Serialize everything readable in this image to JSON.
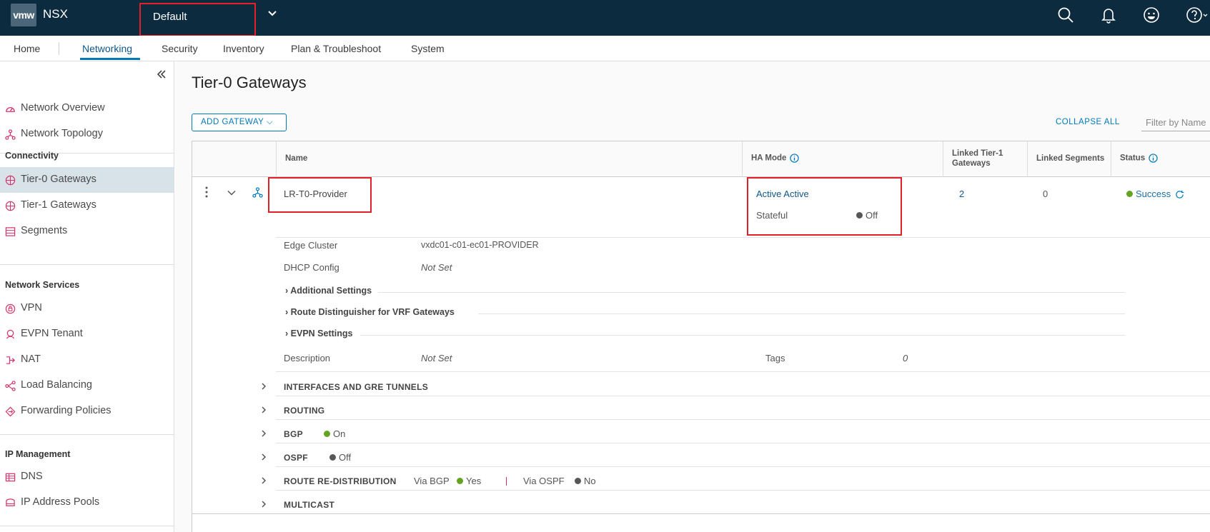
{
  "header": {
    "logo": "vmw",
    "product": "NSX",
    "project": "Default"
  },
  "nav": {
    "tabs": [
      "Home",
      "Networking",
      "Security",
      "Inventory",
      "Plan & Troubleshoot",
      "System"
    ],
    "active": "Networking"
  },
  "sidebar": {
    "top_items": [
      "Network Overview",
      "Network Topology"
    ],
    "groups": [
      {
        "title": "Connectivity",
        "items": [
          "Tier-0 Gateways",
          "Tier-1 Gateways",
          "Segments"
        ]
      },
      {
        "title": "Network Services",
        "items": [
          "VPN",
          "EVPN Tenant",
          "NAT",
          "Load Balancing",
          "Forwarding Policies"
        ]
      },
      {
        "title": "IP Management",
        "items": [
          "DNS",
          "IP Address Pools"
        ]
      }
    ],
    "active": "Tier-0 Gateways"
  },
  "page": {
    "title": "Tier-0 Gateways",
    "add_button": "ADD GATEWAY",
    "collapse_all": "COLLAPSE ALL",
    "filter_placeholder": "Filter by Name"
  },
  "table": {
    "columns": [
      "Name",
      "HA Mode",
      "Linked Tier-1 Gateways",
      "Linked Segments",
      "Status"
    ],
    "col_linked_t1_line1": "Linked Tier-1",
    "col_linked_t1_line2": "Gateways"
  },
  "gateway": {
    "name": "LR-T0-Provider",
    "ha_mode": "Active Active",
    "stateful_label": "Stateful",
    "stateful_value": "Off",
    "linked_t1": "2",
    "linked_segments": "0",
    "status": "Success",
    "edge_cluster_label": "Edge Cluster",
    "edge_cluster_value": "vxdc01-c01-ec01-PROVIDER",
    "dhcp_label": "DHCP Config",
    "dhcp_value": "Not Set",
    "expanders": [
      "Additional Settings",
      "Route Distinguisher for VRF Gateways",
      "EVPN Settings"
    ],
    "description_label": "Description",
    "description_value": "Not Set",
    "tags_label": "Tags",
    "tags_value": "0"
  },
  "sections": {
    "interfaces": "INTERFACES AND GRE TUNNELS",
    "routing": "ROUTING",
    "bgp": "BGP",
    "bgp_value": "On",
    "ospf": "OSPF",
    "ospf_value": "Off",
    "redistribution": "ROUTE RE-DISTRIBUTION",
    "via_bgp_label": "Via BGP",
    "via_bgp_value": "Yes",
    "via_ospf_label": "Via OSPF",
    "via_ospf_value": "No",
    "multicast": "MULTICAST"
  },
  "colors": {
    "topbar": "#0d2b3e",
    "accent": "#0079b8",
    "success": "#62a420",
    "off": "#575757",
    "highlight": "#e12129"
  }
}
